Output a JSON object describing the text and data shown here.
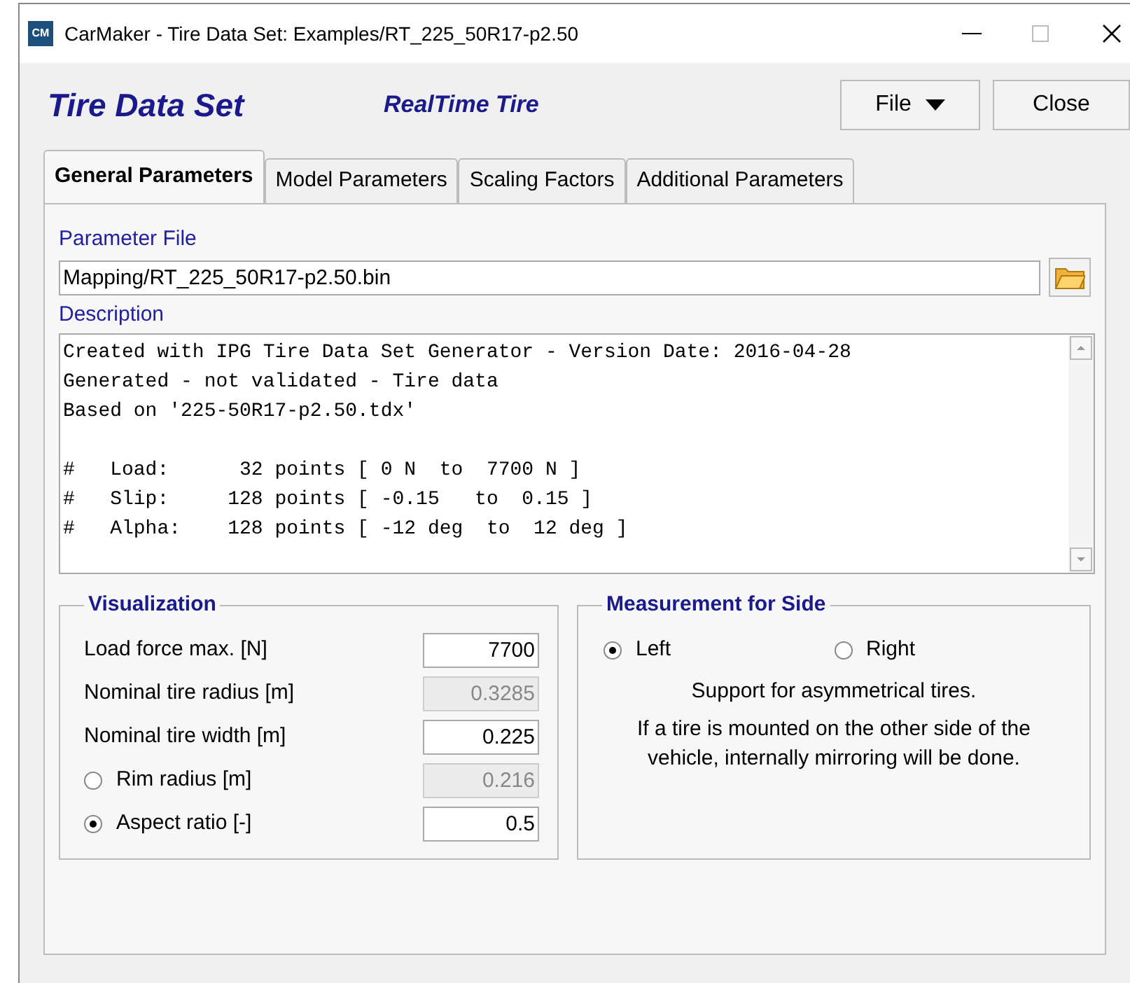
{
  "window": {
    "logo": "CM",
    "title": "CarMaker - Tire Data Set: Examples/RT_225_50R17-p2.50"
  },
  "header": {
    "title": "Tire Data Set",
    "subtitle": "RealTime Tire",
    "buttons": [
      {
        "label": "File",
        "kind": "menu"
      },
      {
        "label": "Close",
        "kind": "plain"
      }
    ]
  },
  "tabs": [
    {
      "label": "General Parameters",
      "selected": true
    },
    {
      "label": "Model Parameters",
      "selected": false
    },
    {
      "label": "Scaling Factors",
      "selected": false
    },
    {
      "label": "Additional Parameters",
      "selected": false
    }
  ],
  "parameter_file": {
    "label": "Parameter File",
    "value": "Mapping/RT_225_50R17-p2.50.bin"
  },
  "description": {
    "label": "Description",
    "blocks": [
      [
        "Created with IPG Tire Data Set Generator - Version Date: 2016-04-28",
        "Generated - not validated - Tire data",
        "Based on '225-50R17-p2.50.tdx'"
      ],
      [
        "#   Load:      32 points [ 0 N  to  7700 N ]",
        "#   Slip:     128 points [ -0.15   to  0.15 ]",
        "#   Alpha:    128 points [ -12 deg  to  12 deg ]"
      ]
    ]
  },
  "visualization": {
    "title": "Visualization",
    "rows": [
      {
        "kind": "field",
        "label": "Load force max. [N]",
        "value": "7700",
        "disabled": false
      },
      {
        "kind": "field",
        "label": "Nominal tire radius [m]",
        "value": "0.3285",
        "disabled": true
      },
      {
        "kind": "field",
        "label": "Nominal tire width [m]",
        "value": "0.225",
        "disabled": false
      },
      {
        "kind": "radio",
        "label": "Rim radius [m]",
        "value": "0.216",
        "disabled": true,
        "selected": false
      },
      {
        "kind": "radio",
        "label": "Aspect ratio [-]",
        "value": "0.5",
        "disabled": false,
        "selected": true
      }
    ]
  },
  "measurement": {
    "title": "Measurement for Side",
    "options": [
      {
        "label": "Left",
        "selected": true
      },
      {
        "label": "Right",
        "selected": false
      }
    ],
    "notes": [
      "Support for asymmetrical tires.",
      "If a tire is mounted on the other side of the vehicle, internally mirroring will be done."
    ]
  }
}
